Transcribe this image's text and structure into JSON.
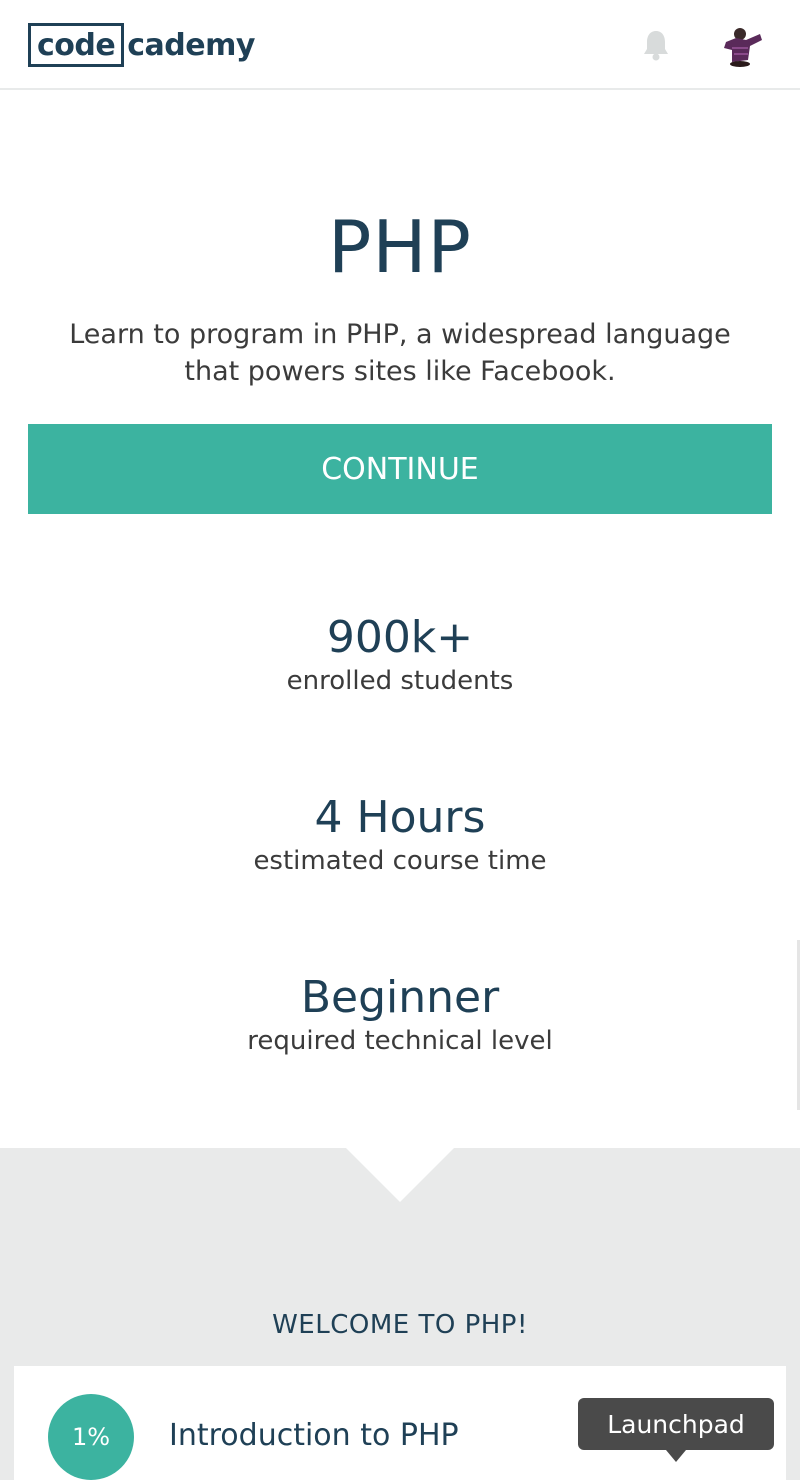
{
  "header": {
    "logo_left": "code",
    "logo_right": "cademy",
    "bell_icon": "bell-icon",
    "avatar_icon": "user-avatar"
  },
  "hero": {
    "title": "PHP",
    "description": "Learn to program in PHP, a widespread language that powers sites like Facebook.",
    "continue_label": "CONTINUE"
  },
  "stats": [
    {
      "value": "900k+",
      "label": "enrolled students"
    },
    {
      "value": "4 Hours",
      "label": "estimated course time"
    },
    {
      "value": "Beginner",
      "label": "required technical level"
    }
  ],
  "lessons": {
    "heading": "WELCOME TO PHP!",
    "items": [
      {
        "progress": "1%",
        "title": "Introduction to PHP"
      }
    ]
  },
  "tooltip": {
    "label": "Launchpad"
  },
  "colors": {
    "primary": "#1f4056",
    "accent": "#3cb3a0",
    "grey_bg": "#e9eaea",
    "tooltip_bg": "#4a4a4a"
  }
}
